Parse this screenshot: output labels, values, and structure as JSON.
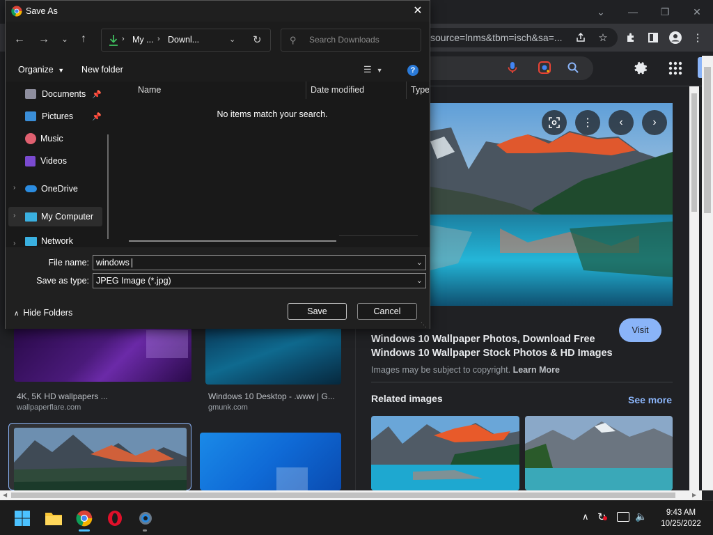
{
  "dialog": {
    "title": "Save As",
    "breadcrumb": [
      "My ...",
      "Downl..."
    ],
    "search_placeholder": "Search Downloads",
    "organize_label": "Organize",
    "new_folder_label": "New folder",
    "nav_items": [
      {
        "label": "Documents",
        "icon": "documents-icon",
        "pinned": true
      },
      {
        "label": "Pictures",
        "icon": "pictures-icon",
        "pinned": true
      },
      {
        "label": "Music",
        "icon": "music-icon",
        "pinned": false
      },
      {
        "label": "Videos",
        "icon": "videos-icon",
        "pinned": false
      },
      {
        "label": "OneDrive",
        "icon": "onedrive-icon",
        "pinned": false
      },
      {
        "label": "My Computer",
        "icon": "computer-icon",
        "pinned": false
      },
      {
        "label": "Network",
        "icon": "network-icon",
        "pinned": false
      }
    ],
    "columns": [
      "Name",
      "Date modified",
      "Type"
    ],
    "empty_message": "No items match your search.",
    "file_name_label": "File name:",
    "file_name_value": "windows",
    "save_type_label": "Save as type:",
    "save_type_value": "JPEG Image (*.jpg)",
    "hide_folders_label": "Hide Folders",
    "save_label": "Save",
    "cancel_label": "Cancel"
  },
  "browser": {
    "url_fragment": "source=lnms&tbm=isch&sa=...",
    "results": [
      {
        "title": "4K, 5K HD wallpapers ...",
        "source": "wallpaperflare.com"
      },
      {
        "title": "Windows 10 Desktop - .www | G...",
        "source": "gmunk.com"
      }
    ],
    "panel": {
      "title": "Windows 10 Wallpaper Photos, Download Free Windows 10 Wallpaper Stock Photos & HD Images",
      "visit_label": "Visit",
      "copyright_text": "Images may be subject to copyright.",
      "learn_more": "Learn More",
      "related_label": "Related images",
      "see_more_label": "See more"
    }
  },
  "taskbar": {
    "time": "9:43 AM",
    "date": "10/25/2022"
  },
  "colors": {
    "accent": "#8ab4f8",
    "dialog_bg": "#191919",
    "browser_bg": "#202124"
  }
}
